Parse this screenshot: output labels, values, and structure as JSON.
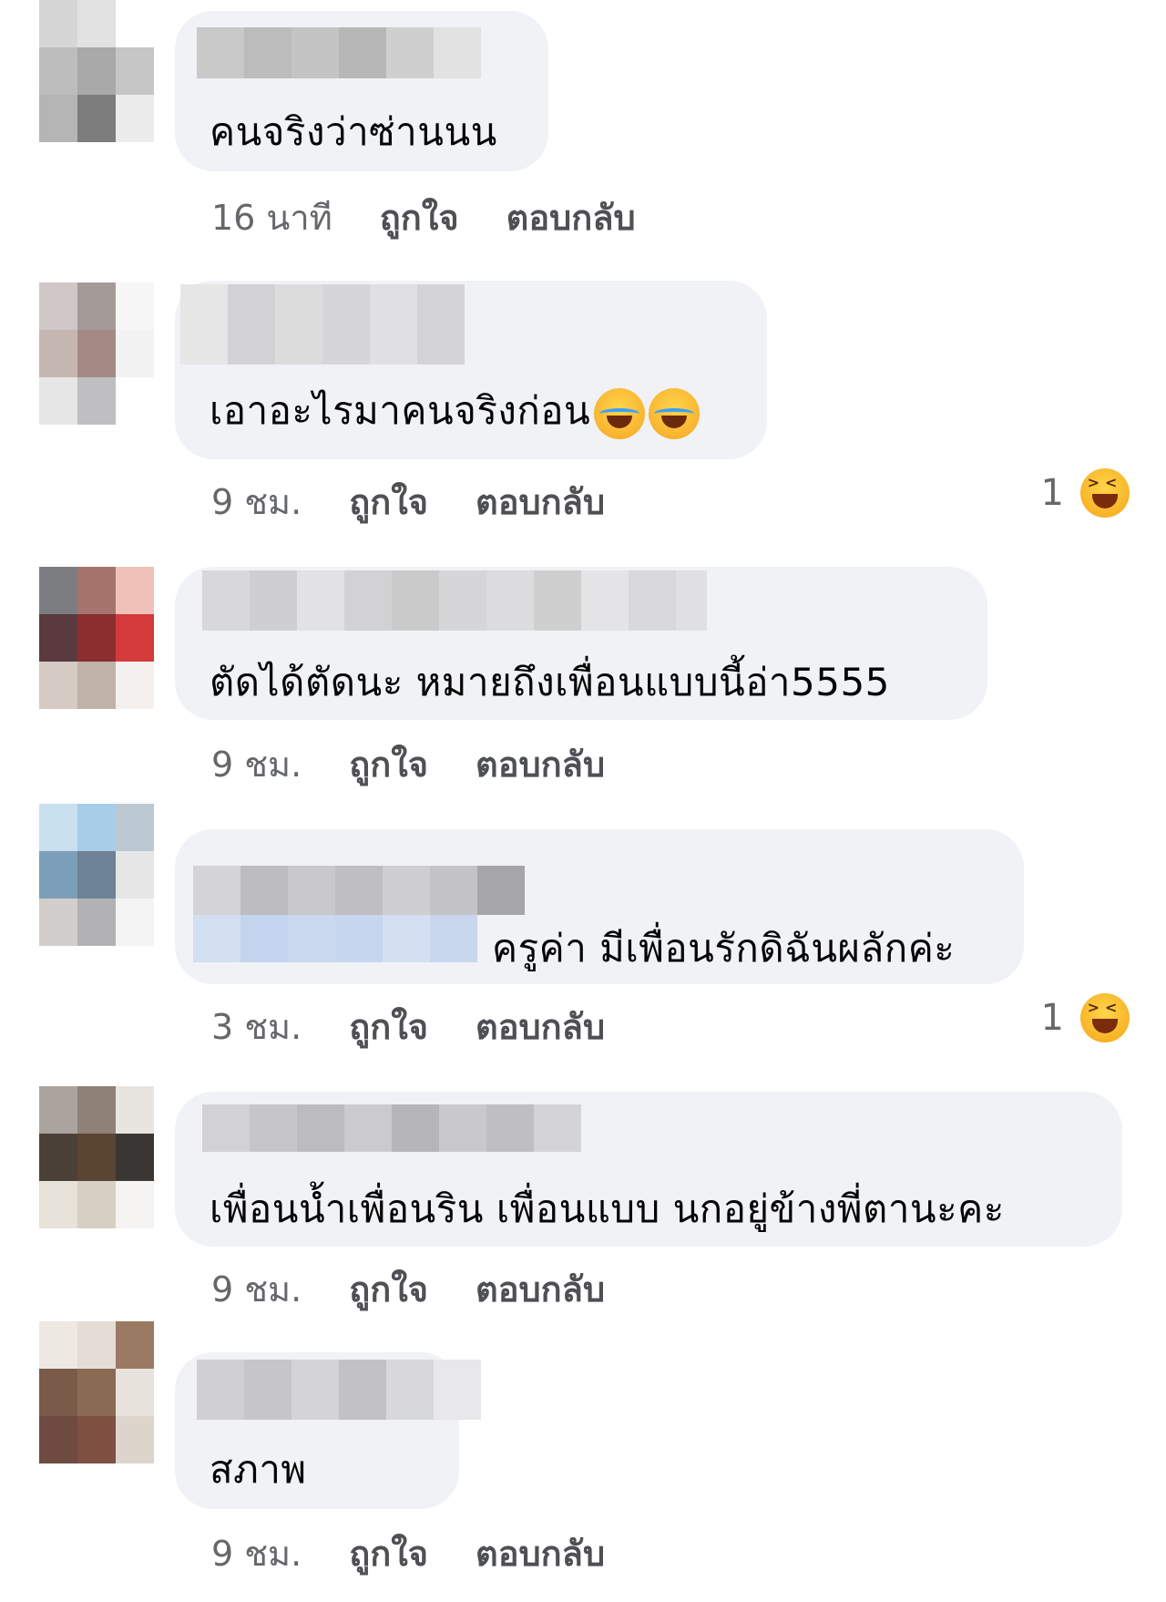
{
  "comments": [
    {
      "text": "คนจริงว่าซ่านนน",
      "time": "16 นาที",
      "like": "ถูกใจ",
      "reply": "ตอบกลับ",
      "reaction_count": ""
    },
    {
      "text": "เอาอะไรมาคนจริงก่อน",
      "emoji": "laughing-tears-emoji",
      "time": "9 ชม.",
      "like": "ถูกใจ",
      "reply": "ตอบกลับ",
      "reaction_count": "1",
      "reaction_icon": "haha-reaction-icon"
    },
    {
      "text": "ตัดได้ตัดนะ หมายถึงเพื่อนแบบนี้อ่า5555",
      "time": "9 ชม.",
      "like": "ถูกใจ",
      "reply": "ตอบกลับ",
      "reaction_count": ""
    },
    {
      "text": "ครูค่า มีเพื่อนรักดิฉันผลักค่ะ",
      "time": "3 ชม.",
      "like": "ถูกใจ",
      "reply": "ตอบกลับ",
      "reaction_count": "1",
      "reaction_icon": "haha-reaction-icon"
    },
    {
      "text": "เพื่อนน้ำเพื่อนริน   เพื่อนแบบ นกอยู่ข้างพี่ตานะคะ",
      "time": "9 ชม.",
      "like": "ถูกใจ",
      "reply": "ตอบกลับ",
      "reaction_count": ""
    },
    {
      "text": "สภาพ",
      "time": "9 ชม.",
      "like": "ถูกใจ",
      "reply": "ตอบกลับ",
      "reaction_count": ""
    }
  ],
  "colors": {
    "bubble_bg": "#f0f2f5",
    "meta_text": "#65676b",
    "comment_text": "#050505",
    "haha_yellow": "#f7b125"
  }
}
